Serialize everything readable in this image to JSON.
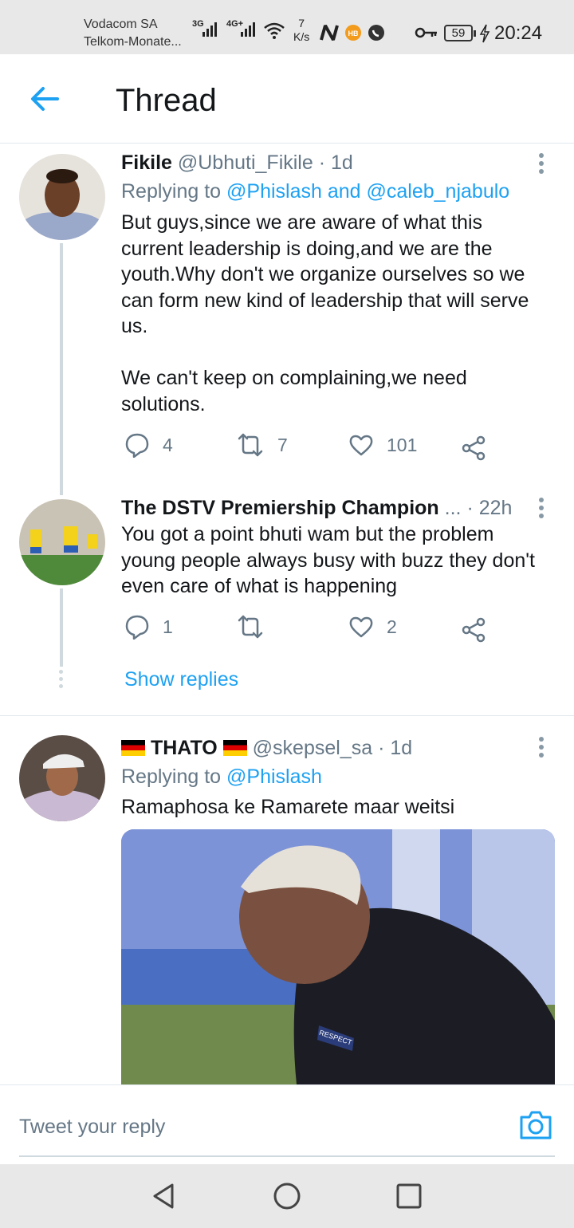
{
  "status_bar": {
    "carrier_1": "Vodacom SA",
    "carrier_2": "Telkom-Monate...",
    "signal_1": "3G",
    "signal_2": "4G+",
    "speed_value": "7",
    "speed_unit": "K/s",
    "battery": "59",
    "time": "20:24"
  },
  "header": {
    "title": "Thread"
  },
  "tweets": [
    {
      "name": "Fikile",
      "handle": "@Ubhuti_Fikile",
      "age": "1d",
      "reply_prefix": "Replying to",
      "reply_to": "@Phislash and @caleb_njabulo",
      "text": "But guys,since we are aware of what this\ncurrent leadership is doing,and we are the\nyouth.Why don't we organize ourselves so we\ncan form new kind of leadership that will serve\nus.\n\nWe can't keep on complaining,we need\nsolutions.",
      "replies": "4",
      "retweets": "7",
      "likes": "101"
    },
    {
      "name": "The DSTV Premiership Champion",
      "ellipsis": "...",
      "age": "22h",
      "text": "You got a point bhuti wam but the problem\nyoung people always busy with buzz they don't\neven care of what is happening",
      "replies": "1",
      "retweets": "",
      "likes": "2",
      "show_replies": "Show replies"
    },
    {
      "name": "THATO",
      "handle": "@skepsel_sa",
      "age": "1d",
      "reply_prefix": "Replying to",
      "reply_to": "@Phislash",
      "text": "Ramaphosa ke Ramarete maar weitsi",
      "media_badge": "RESPECT"
    }
  ],
  "reply_bar": {
    "placeholder": "Tweet your reply"
  },
  "colors": {
    "accent": "#1da1f2",
    "muted": "#657786",
    "text": "#14171a"
  }
}
